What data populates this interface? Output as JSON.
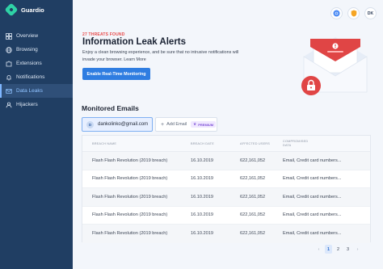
{
  "app": {
    "name": "Guardio"
  },
  "sidebar": {
    "items": [
      {
        "label": "Overview",
        "icon": "grid-icon",
        "active": false
      },
      {
        "label": "Browsing",
        "icon": "globe-icon",
        "active": false
      },
      {
        "label": "Extensions",
        "icon": "puzzle-icon",
        "active": false
      },
      {
        "label": "Notifications",
        "icon": "bell-icon",
        "active": false
      },
      {
        "label": "Data Leaks",
        "icon": "mail-icon",
        "active": true
      },
      {
        "label": "Hijackers",
        "icon": "user-icon",
        "active": false
      }
    ]
  },
  "topbar": {
    "avatar_initials": "DK"
  },
  "hero": {
    "threats_label": "27 THREATS FOUND",
    "title": "Information Leak Alerts",
    "description": "Enjoy a clean browsing experience, and be sure that no intrusive notifications will invade your browser. Learn More",
    "cta": "Enable Real-Time Monitoring"
  },
  "monitored": {
    "title": "Monitored Emails",
    "email": {
      "initial": "D",
      "address": "dankolinko@gmail.com"
    },
    "add_label": "Add Email",
    "premium_label": "PREMIUM"
  },
  "table": {
    "headers": [
      "BREACH NAME",
      "BREACH DATE",
      "AFFECTED USERS",
      "COMPROMISED DATA"
    ],
    "rows": [
      [
        "Flash Flash Revolution (2019 breach)",
        "16.10.2019",
        "622,161,052",
        "Email, Credit card numbers..."
      ],
      [
        "Flash Flash Revolution (2019 breach)",
        "16.10.2019",
        "622,161,052",
        "Email, Credit card numbers..."
      ],
      [
        "Flash Flash Revolution (2019 breach)",
        "16.10.2019",
        "622,161,052",
        "Email, Credit card numbers..."
      ],
      [
        "Flash Flash Revolution (2019 breach)",
        "16.10.2019",
        "622,161,052",
        "Email, Credit card numbers..."
      ],
      [
        "Flash Flash Revolution (2019 breach)",
        "16.10.2019",
        "622,161,052",
        "Email, Credit card numbers..."
      ]
    ]
  },
  "pagination": {
    "prev": "‹",
    "pages": [
      "1",
      "2",
      "3"
    ],
    "next": "›",
    "current": "1"
  },
  "colors": {
    "sidebar": "#203e63",
    "accent": "#2f7de1",
    "danger": "#e84b4b",
    "brand": "#2fd2a6"
  }
}
